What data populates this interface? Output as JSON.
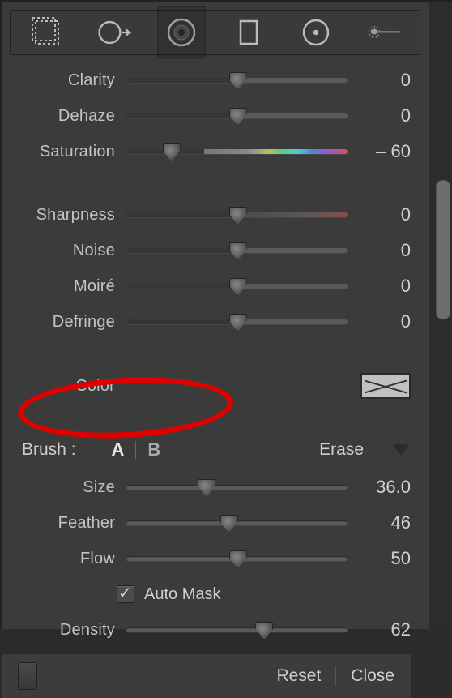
{
  "toolbar": {
    "tool_crop": "crop-tool",
    "tool_spot": "spot-removal-tool",
    "tool_redeye": "red-eye-tool",
    "tool_graduated": "graduated-filter-tool",
    "tool_radial": "radial-filter-tool",
    "tool_brush": "adjustment-brush-tool"
  },
  "sliders": {
    "clarity": {
      "label": "Clarity",
      "value": "0",
      "pos": 50,
      "type": "split"
    },
    "dehaze": {
      "label": "Dehaze",
      "value": "0",
      "pos": 50,
      "type": "split"
    },
    "saturation": {
      "label": "Saturation",
      "value": "– 60",
      "pos": 20,
      "type": "sat"
    },
    "sharpness": {
      "label": "Sharpness",
      "value": "0",
      "pos": 50,
      "type": "sharp"
    },
    "noise": {
      "label": "Noise",
      "value": "0",
      "pos": 50,
      "type": "split"
    },
    "moire": {
      "label": "Moiré",
      "value": "0",
      "pos": 50,
      "type": "split"
    },
    "defringe": {
      "label": "Defringe",
      "value": "0",
      "pos": 50,
      "type": "split"
    },
    "size": {
      "label": "Size",
      "value": "36.0",
      "pos": 36,
      "type": "full"
    },
    "feather": {
      "label": "Feather",
      "value": "46",
      "pos": 46,
      "type": "full"
    },
    "flow": {
      "label": "Flow",
      "value": "50",
      "pos": 50,
      "type": "full"
    },
    "density": {
      "label": "Density",
      "value": "62",
      "pos": 62,
      "type": "full"
    }
  },
  "color": {
    "label": "Color"
  },
  "brush": {
    "label": "Brush :",
    "tabA": "A",
    "tabB": "B",
    "erase": "Erase",
    "automask": "Auto Mask"
  },
  "footer": {
    "reset": "Reset",
    "close": "Close"
  }
}
